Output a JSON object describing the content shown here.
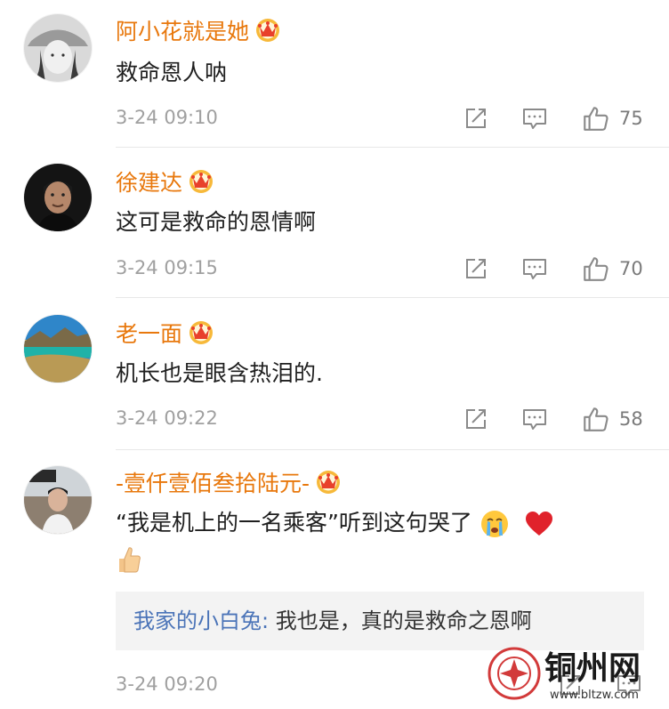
{
  "comments": [
    {
      "name": "阿小花就是她",
      "text": "救命恩人呐",
      "time": "3-24 09:10",
      "likes": "75"
    },
    {
      "name": "徐建达",
      "text": "这可是救命的恩情啊",
      "time": "3-24 09:15",
      "likes": "70"
    },
    {
      "name": "老一面",
      "text": "机长也是眼含热泪的.",
      "time": "3-24 09:22",
      "likes": "58"
    },
    {
      "name": "-壹仟壹佰叁拾陆元-",
      "text": "“我是机上的一名乘客”听到这句哭了",
      "time": "3-24 09:20",
      "likes": "",
      "reply": {
        "user": "我家的小白兔",
        "sep": ": ",
        "text": "我也是，真的是救命之恩啊"
      }
    }
  ],
  "icons": {
    "repost": "repost-icon",
    "comment": "comment-icon",
    "like": "like-icon",
    "badge": "crown-badge-icon"
  },
  "colors": {
    "name": "#e8780d",
    "reply_user": "#4b74b8",
    "text": "#1f1f1f",
    "meta": "#a0a0a0"
  },
  "watermark": {
    "title": "铜州网",
    "url": "www.bltzw.com"
  }
}
